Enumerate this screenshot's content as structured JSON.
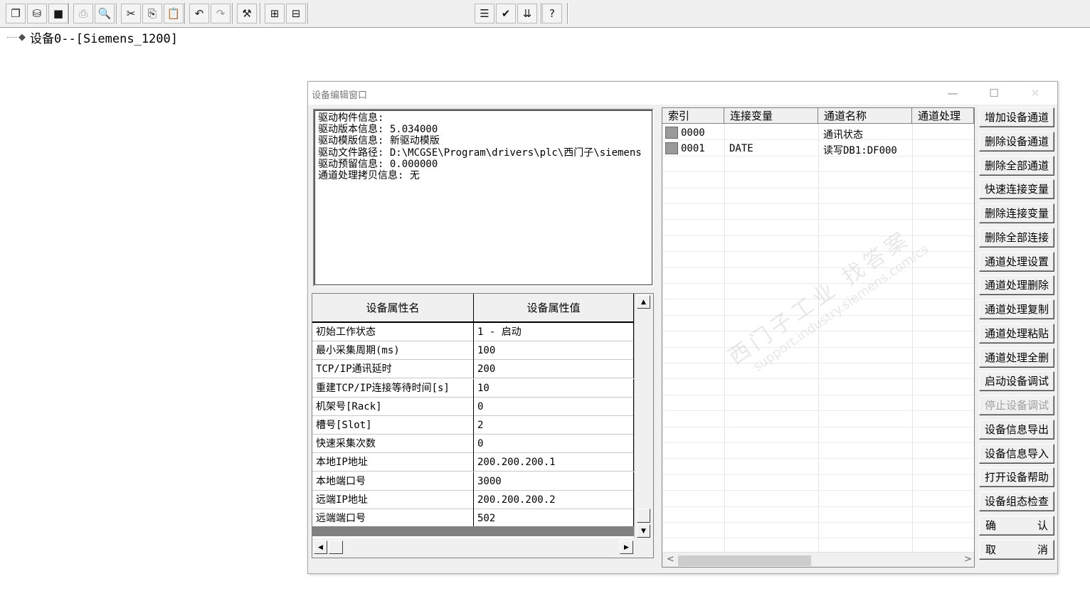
{
  "toolbar": {
    "groups": [
      [
        "new-window-icon",
        "database-icon",
        "save-icon"
      ],
      [
        "print-icon",
        "print-preview-icon"
      ],
      [
        "cut-icon",
        "copy-icon",
        "paste-icon"
      ],
      [
        "undo-icon",
        "redo-icon"
      ],
      [
        "tools-icon"
      ],
      [
        "tree-expand-icon",
        "tree-collapse-icon"
      ],
      [
        "properties-icon",
        "check-icon",
        "sort-icon"
      ],
      [
        "help-icon"
      ]
    ],
    "glyphs": {
      "new-window-icon": "❐",
      "database-icon": "⛁",
      "save-icon": "■",
      "print-icon": "⎙",
      "print-preview-icon": "🔍",
      "cut-icon": "✂",
      "copy-icon": "⎘",
      "paste-icon": "📋",
      "undo-icon": "↶",
      "redo-icon": "↷",
      "tools-icon": "⚒",
      "tree-expand-icon": "⊞",
      "tree-collapse-icon": "⊟",
      "properties-icon": "☰",
      "check-icon": "✔",
      "sort-icon": "⇊",
      "help-icon": "?"
    }
  },
  "tree": {
    "root_label": "设备0--[Siemens_1200]"
  },
  "dialog": {
    "title": "设备编辑窗口",
    "controls": {
      "minimize": "—",
      "maximize": "☐",
      "close": "✕"
    },
    "info_lines": [
      "驱动构件信息:",
      "驱动版本信息: 5.034000",
      "驱动模版信息: 新驱动模版",
      "驱动文件路径: D:\\MCGSE\\Program\\drivers\\plc\\西门子\\siemens",
      "驱动预留信息: 0.000000",
      "通道处理拷贝信息: 无"
    ],
    "props": {
      "headers": [
        "设备属性名",
        "设备属性值"
      ],
      "rows": [
        [
          "初始工作状态",
          "1 - 启动"
        ],
        [
          "最小采集周期(ms)",
          "100"
        ],
        [
          "TCP/IP通讯延时",
          "200"
        ],
        [
          "重建TCP/IP连接等待时间[s]",
          "10"
        ],
        [
          "机架号[Rack]",
          "0"
        ],
        [
          "槽号[Slot]",
          "2"
        ],
        [
          "快速采集次数",
          "0"
        ],
        [
          "本地IP地址",
          "200.200.200.1"
        ],
        [
          "本地端口号",
          "3000"
        ],
        [
          "远端IP地址",
          "200.200.200.2"
        ],
        [
          "远端端口号",
          "502"
        ]
      ]
    },
    "grid": {
      "headers": [
        "索引",
        "连接变量",
        "通道名称",
        "通道处理"
      ],
      "rows": [
        [
          "0000",
          "",
          "通讯状态",
          ""
        ],
        [
          "0001",
          "DATE",
          "读写DB1:DF000",
          ""
        ]
      ]
    },
    "buttons": [
      {
        "label": "增加设备通道",
        "enabled": true
      },
      {
        "label": "删除设备通道",
        "enabled": true
      },
      {
        "label": "删除全部通道",
        "enabled": true
      },
      {
        "label": "快速连接变量",
        "enabled": true
      },
      {
        "label": "删除连接变量",
        "enabled": true
      },
      {
        "label": "删除全部连接",
        "enabled": true
      },
      {
        "label": "通道处理设置",
        "enabled": true
      },
      {
        "label": "通道处理删除",
        "enabled": true
      },
      {
        "label": "通道处理复制",
        "enabled": true
      },
      {
        "label": "通道处理粘贴",
        "enabled": true
      },
      {
        "label": "通道处理全删",
        "enabled": true
      },
      {
        "label": "启动设备调试",
        "enabled": true
      },
      {
        "label": "停止设备调试",
        "enabled": false
      },
      {
        "label": "设备信息导出",
        "enabled": true
      },
      {
        "label": "设备信息导入",
        "enabled": true
      },
      {
        "label": "打开设备帮助",
        "enabled": true
      },
      {
        "label": "设备组态检查",
        "enabled": true
      }
    ],
    "confirm": {
      "left": "确",
      "right": "认"
    },
    "cancel": {
      "left": "取",
      "right": "消"
    }
  },
  "watermark": {
    "line1": "西门子工业 找答案",
    "line2": "support.industry.siemens.com/cs"
  }
}
